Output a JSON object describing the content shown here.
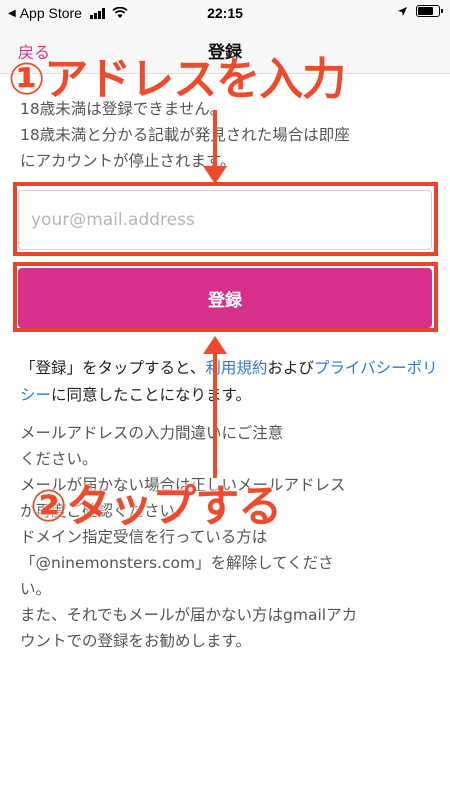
{
  "status_bar": {
    "back_app": "App Store",
    "time": "22:15",
    "battery_level": 0.75
  },
  "nav": {
    "back_label": "戻る",
    "title": "登録"
  },
  "notice": {
    "line1": "18歳未満は登録できません。",
    "line2": "18歳未満と分かる記載が発見された場合は即座",
    "line3": "にアカウントが停止されます。"
  },
  "form": {
    "email_placeholder": "your@mail.address",
    "email_value": "",
    "submit_label": "登録"
  },
  "terms": {
    "prefix": "「登録」をタップすると、",
    "terms_link": "利用規約",
    "middle": "および",
    "privacy_link": "プライバシーポリシー",
    "suffix": "に同意したことになります。"
  },
  "note": {
    "line1": "メールアドレスの入力間違いにご注意",
    "line2": "ください。",
    "line3": "メールが届かない場合は正しいメールアドレス",
    "line4": "か再度ご確認ください。",
    "line5": "ドメイン指定受信を行っている方は",
    "line6": "「@ninemonsters.com」を解除してくださ",
    "line7": "い。",
    "line8": "また、それでもメールが届かない方はgmailアカ",
    "line9": "ウントでの登録をお勧めします。"
  },
  "annotations": {
    "step1": "①アドレスを入力",
    "step2": "②タップする",
    "color": "#ee4a2c"
  },
  "colors": {
    "accent": "#d6308a",
    "link": "#2f7ad6"
  }
}
